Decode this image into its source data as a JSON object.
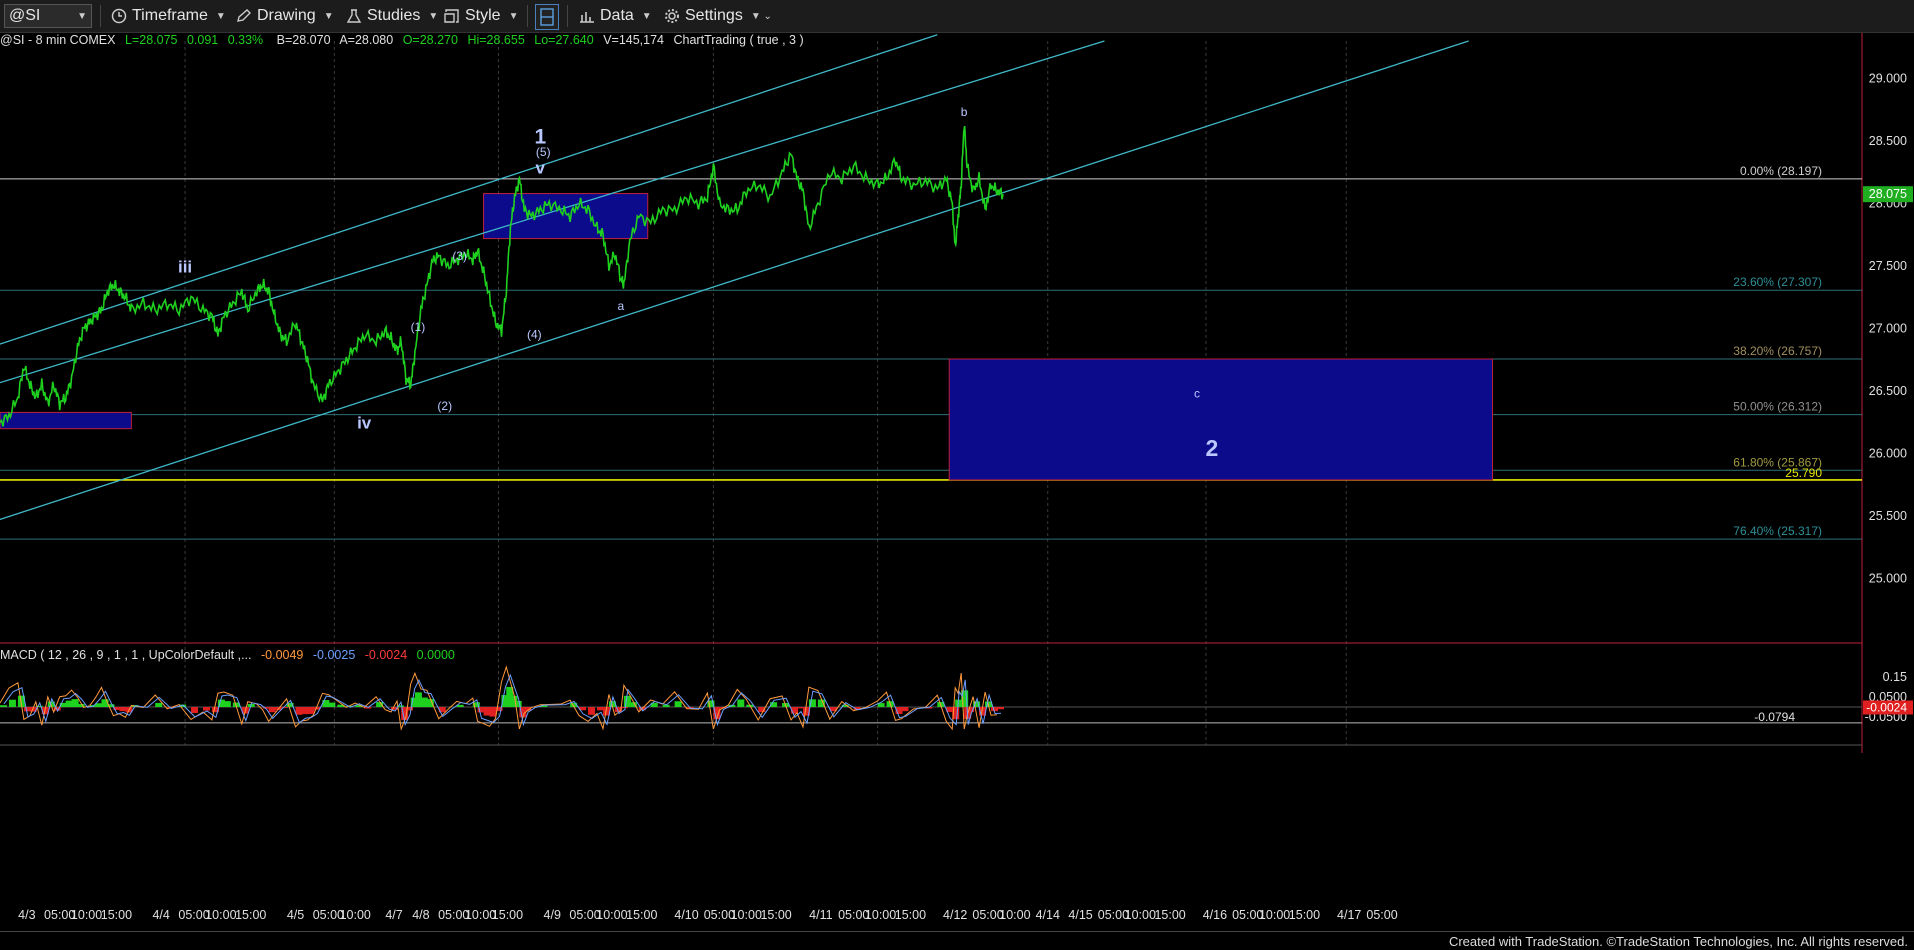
{
  "toolbar": {
    "symbol": "@SI",
    "timeframe": "Timeframe",
    "drawing": "Drawing",
    "studies": "Studies",
    "style": "Style",
    "data": "Data",
    "settings": "Settings"
  },
  "header": {
    "symbol_info": "@SI - 8 min  COMEX",
    "last": "L=28.075",
    "change": "0.091",
    "change_pct": "0.33%",
    "bid": "B=28.070",
    "ask": "A=28.080",
    "open": "O=28.270",
    "high": "Hi=28.655",
    "low": "Lo=27.640",
    "volume": "V=145,174",
    "study": "ChartTrading ( true , 3 )"
  },
  "macd_header": {
    "label": "MACD ( 12 , 26 , 9 , 1 , 1 , UpColorDefault ,...",
    "v1": "-0.0049",
    "v2": "-0.0025",
    "v3": "-0.0024",
    "v4": "0.0000"
  },
  "footer": "Created with TradeStation. ©TradeStation Technologies, Inc. All rights reserved.",
  "colors": {
    "price": "#1fd11f",
    "channel": "#3fb8c8",
    "box": "#0b0b8c",
    "box_border": "#c0203a",
    "fib": "#2f6f78",
    "yellow": "#e8e800",
    "white_line": "#d0d0d0"
  },
  "chart_data": {
    "type": "line",
    "title": "@SI - 8 min  COMEX",
    "ylim": [
      24.55,
      29.3
    ],
    "y_ticks": [
      {
        "v": 29.0,
        "label": "29.000"
      },
      {
        "v": 28.5,
        "label": "28.500"
      },
      {
        "v": 28.0,
        "label": "28.000"
      },
      {
        "v": 27.5,
        "label": "27.500"
      },
      {
        "v": 27.0,
        "label": "27.000"
      },
      {
        "v": 26.5,
        "label": "26.500"
      },
      {
        "v": 26.0,
        "label": "26.000"
      },
      {
        "v": 25.5,
        "label": "25.500"
      },
      {
        "v": 25.0,
        "label": "25.000"
      }
    ],
    "x_range": [
      0,
      16.8
    ],
    "x_ticks": [
      {
        "t": 0.45,
        "label": "4/3"
      },
      {
        "t": 1.0,
        "label": "05:00"
      },
      {
        "t": 1.45,
        "label": "10:00"
      },
      {
        "t": 1.95,
        "label": "15:00"
      },
      {
        "t": 2.7,
        "label": "4/4"
      },
      {
        "t": 3.25,
        "label": "05:00"
      },
      {
        "t": 3.7,
        "label": "10:00"
      },
      {
        "t": 4.2,
        "label": "15:00"
      },
      {
        "t": 4.95,
        "label": "4/5"
      },
      {
        "t": 5.5,
        "label": "05:00"
      },
      {
        "t": 5.95,
        "label": "10:00"
      },
      {
        "t": 6.6,
        "label": "4/7"
      },
      {
        "t": 7.05,
        "label": "4/8"
      },
      {
        "t": 7.6,
        "label": "05:00"
      },
      {
        "t": 8.05,
        "label": "10:00"
      },
      {
        "t": 8.5,
        "label": "15:00"
      },
      {
        "t": 9.25,
        "label": "4/9"
      },
      {
        "t": 9.8,
        "label": "05:00"
      },
      {
        "t": 10.25,
        "label": "10:00"
      },
      {
        "t": 10.75,
        "label": "15:00"
      },
      {
        "t": 11.5,
        "label": "4/10"
      },
      {
        "t": 12.05,
        "label": "05:00"
      },
      {
        "t": 12.5,
        "label": "10:00"
      },
      {
        "t": 13.0,
        "label": "15:00"
      },
      {
        "t": 13.75,
        "label": "4/11"
      },
      {
        "t": 14.3,
        "label": "05:00"
      },
      {
        "t": 14.75,
        "label": "10:00"
      },
      {
        "t": 15.25,
        "label": "15:00"
      },
      {
        "t": 16.0,
        "label": "4/12"
      },
      {
        "t": 16.55,
        "label": "05:00"
      }
    ],
    "x_ticks_b": [
      {
        "t": 17.0,
        "label": "10:00"
      },
      {
        "t": 17.55,
        "label": "4/14"
      },
      {
        "t": 18.1,
        "label": "4/15"
      },
      {
        "t": 18.65,
        "label": "05:00"
      },
      {
        "t": 19.1,
        "label": "10:00"
      },
      {
        "t": 19.6,
        "label": "15:00"
      },
      {
        "t": 20.35,
        "label": "4/16"
      },
      {
        "t": 20.9,
        "label": "05:00"
      },
      {
        "t": 21.35,
        "label": "10:00"
      },
      {
        "t": 21.85,
        "label": "15:00"
      },
      {
        "t": 22.6,
        "label": "4/17"
      },
      {
        "t": 23.15,
        "label": "05:00"
      }
    ],
    "last_price": "28.075",
    "fib_levels": [
      {
        "v": 28.197,
        "label": "0.00% (28.197)",
        "color": "#d0d0d0"
      },
      {
        "v": 27.307,
        "label": "23.60% (27.307)",
        "color": "#2f8f98"
      },
      {
        "v": 26.757,
        "label": "38.20% (26.757)",
        "color": "#a09060"
      },
      {
        "v": 26.312,
        "label": "50.00% (26.312)",
        "color": "#909090"
      },
      {
        "v": 25.867,
        "label": "61.80% (25.867)",
        "color": "#a09a40"
      },
      {
        "v": 25.317,
        "label": "76.40% (25.317)",
        "color": "#2f8f98"
      }
    ],
    "support_line": {
      "v": 25.79,
      "label": "25.790"
    },
    "price_series": [
      [
        0.0,
        26.25
      ],
      [
        0.15,
        26.3
      ],
      [
        0.3,
        26.45
      ],
      [
        0.4,
        26.7
      ],
      [
        0.5,
        26.55
      ],
      [
        0.6,
        26.45
      ],
      [
        0.7,
        26.55
      ],
      [
        0.8,
        26.4
      ],
      [
        0.9,
        26.55
      ],
      [
        1.0,
        26.4
      ],
      [
        1.1,
        26.45
      ],
      [
        1.2,
        26.6
      ],
      [
        1.3,
        26.85
      ],
      [
        1.4,
        27.0
      ],
      [
        1.5,
        27.05
      ],
      [
        1.6,
        27.1
      ],
      [
        1.7,
        27.15
      ],
      [
        1.8,
        27.3
      ],
      [
        1.9,
        27.35
      ],
      [
        2.0,
        27.3
      ],
      [
        2.1,
        27.25
      ],
      [
        2.2,
        27.15
      ],
      [
        2.4,
        27.2
      ],
      [
        2.6,
        27.15
      ],
      [
        2.8,
        27.2
      ],
      [
        3.0,
        27.15
      ],
      [
        3.2,
        27.25
      ],
      [
        3.4,
        27.15
      ],
      [
        3.55,
        27.1
      ],
      [
        3.65,
        26.95
      ],
      [
        3.75,
        27.1
      ],
      [
        3.9,
        27.2
      ],
      [
        4.05,
        27.3
      ],
      [
        4.15,
        27.15
      ],
      [
        4.3,
        27.3
      ],
      [
        4.4,
        27.35
      ],
      [
        4.5,
        27.3
      ],
      [
        4.6,
        27.1
      ],
      [
        4.7,
        26.95
      ],
      [
        4.8,
        26.9
      ],
      [
        4.95,
        27.05
      ],
      [
        5.05,
        26.9
      ],
      [
        5.15,
        26.75
      ],
      [
        5.25,
        26.55
      ],
      [
        5.4,
        26.42
      ],
      [
        5.5,
        26.55
      ],
      [
        5.65,
        26.65
      ],
      [
        5.8,
        26.75
      ],
      [
        5.95,
        26.85
      ],
      [
        6.1,
        26.95
      ],
      [
        6.3,
        26.9
      ],
      [
        6.45,
        26.98
      ],
      [
        6.55,
        26.92
      ],
      [
        6.65,
        26.82
      ],
      [
        6.72,
        26.9
      ],
      [
        6.8,
        26.6
      ],
      [
        6.88,
        26.55
      ],
      [
        6.95,
        26.8
      ],
      [
        7.05,
        27.15
      ],
      [
        7.15,
        27.35
      ],
      [
        7.25,
        27.55
      ],
      [
        7.35,
        27.58
      ],
      [
        7.5,
        27.5
      ],
      [
        7.65,
        27.55
      ],
      [
        7.8,
        27.6
      ],
      [
        7.92,
        27.55
      ],
      [
        8.0,
        27.62
      ],
      [
        8.1,
        27.45
      ],
      [
        8.2,
        27.25
      ],
      [
        8.3,
        27.05
      ],
      [
        8.4,
        26.98
      ],
      [
        8.48,
        27.3
      ],
      [
        8.55,
        27.8
      ],
      [
        8.62,
        28.05
      ],
      [
        8.7,
        28.2
      ],
      [
        8.78,
        27.95
      ],
      [
        8.9,
        27.9
      ],
      [
        9.05,
        27.95
      ],
      [
        9.2,
        28.0
      ],
      [
        9.4,
        27.95
      ],
      [
        9.55,
        27.9
      ],
      [
        9.7,
        28.0
      ],
      [
        9.85,
        27.95
      ],
      [
        10.0,
        27.8
      ],
      [
        10.1,
        27.75
      ],
      [
        10.2,
        27.5
      ],
      [
        10.3,
        27.6
      ],
      [
        10.4,
        27.4
      ],
      [
        10.45,
        27.35
      ],
      [
        10.55,
        27.7
      ],
      [
        10.7,
        27.9
      ],
      [
        10.9,
        27.85
      ],
      [
        11.1,
        27.95
      ],
      [
        11.3,
        27.95
      ],
      [
        11.5,
        28.05
      ],
      [
        11.7,
        28.0
      ],
      [
        11.85,
        28.05
      ],
      [
        11.95,
        28.3
      ],
      [
        12.05,
        28.0
      ],
      [
        12.2,
        27.95
      ],
      [
        12.35,
        27.95
      ],
      [
        12.5,
        28.1
      ],
      [
        12.7,
        28.15
      ],
      [
        12.9,
        28.05
      ],
      [
        13.1,
        28.25
      ],
      [
        13.25,
        28.4
      ],
      [
        13.35,
        28.2
      ],
      [
        13.45,
        28.1
      ],
      [
        13.55,
        27.8
      ],
      [
        13.7,
        28.0
      ],
      [
        13.9,
        28.25
      ],
      [
        14.1,
        28.2
      ],
      [
        14.3,
        28.3
      ],
      [
        14.5,
        28.2
      ],
      [
        14.7,
        28.15
      ],
      [
        14.85,
        28.2
      ],
      [
        15.0,
        28.35
      ],
      [
        15.1,
        28.2
      ],
      [
        15.3,
        28.15
      ],
      [
        15.5,
        28.18
      ],
      [
        15.7,
        28.12
      ],
      [
        15.85,
        28.2
      ],
      [
        15.95,
        28.0
      ],
      [
        16.0,
        27.65
      ],
      [
        16.05,
        27.9
      ],
      [
        16.1,
        28.15
      ],
      [
        16.15,
        28.65
      ],
      [
        16.2,
        28.3
      ],
      [
        16.3,
        28.1
      ],
      [
        16.4,
        28.2
      ],
      [
        16.5,
        27.95
      ],
      [
        16.6,
        28.15
      ],
      [
        16.7,
        28.1
      ],
      [
        16.8,
        28.075
      ]
    ],
    "channel_lines": [
      [
        [
          -0.8,
          26.75
        ],
        [
          15.7,
          29.35
        ]
      ],
      [
        [
          -0.8,
          26.45
        ],
        [
          18.5,
          29.3
        ]
      ],
      [
        [
          -0.8,
          25.35
        ],
        [
          24.6,
          29.3
        ]
      ]
    ],
    "boxes": [
      {
        "t0": -0.8,
        "t1": 2.2,
        "v0": 26.2,
        "v1": 26.33
      },
      {
        "t0": 8.1,
        "t1": 10.85,
        "v0": 27.72,
        "v1": 28.08
      },
      {
        "t0": 15.9,
        "t1": 25.0,
        "v0": 25.79,
        "v1": 26.757
      }
    ],
    "wave_labels": [
      {
        "t": 3.1,
        "v": 27.45,
        "label": "iii",
        "size": 17,
        "bold": true
      },
      {
        "t": 6.1,
        "v": 26.2,
        "label": "iv",
        "size": 17,
        "bold": true
      },
      {
        "t": 9.05,
        "v": 28.48,
        "label": "1",
        "size": 21,
        "bold": true
      },
      {
        "t": 9.1,
        "v": 28.38,
        "label": "(5)",
        "size": 12,
        "bold": false
      },
      {
        "t": 9.05,
        "v": 28.24,
        "label": "v",
        "size": 17,
        "bold": true
      },
      {
        "t": 7.7,
        "v": 27.55,
        "label": "(3)",
        "size": 12,
        "bold": false
      },
      {
        "t": 7.0,
        "v": 26.98,
        "label": "(1)",
        "size": 12,
        "bold": false
      },
      {
        "t": 7.45,
        "v": 26.35,
        "label": "(2)",
        "size": 12,
        "bold": false
      },
      {
        "t": 8.95,
        "v": 26.92,
        "label": "(4)",
        "size": 12,
        "bold": false
      },
      {
        "t": 10.4,
        "v": 27.15,
        "label": "a",
        "size": 12,
        "bold": false
      },
      {
        "t": 16.15,
        "v": 28.7,
        "label": "b",
        "size": 12,
        "bold": false
      },
      {
        "t": 20.05,
        "v": 26.45,
        "label": "c",
        "size": 12,
        "bold": false
      },
      {
        "t": 20.3,
        "v": 25.98,
        "label": "2",
        "size": 23,
        "bold": true
      }
    ],
    "macd": {
      "y_ticks": [
        {
          "v": 0.15,
          "label": "0.15"
        },
        {
          "v": 0.05,
          "label": "0.0500"
        },
        {
          "v": -0.05,
          "label": "-0.0500"
        }
      ],
      "value_label": "-0.0024",
      "signal_label": "-0.0794",
      "ylim": [
        -0.13,
        0.22
      ]
    }
  }
}
